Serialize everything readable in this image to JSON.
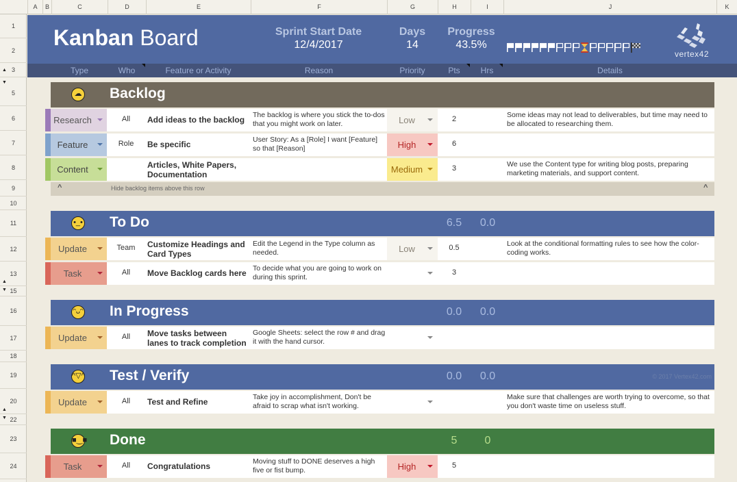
{
  "spreadsheet": {
    "columns": [
      "A",
      "B",
      "C",
      "D",
      "E",
      "F",
      "G",
      "H",
      "I",
      "J",
      "K"
    ],
    "rows": [
      "1",
      "2",
      "3",
      "5",
      "6",
      "7",
      "8",
      "9",
      "10",
      "11",
      "12",
      "13",
      "15",
      "16",
      "17",
      "18",
      "19",
      "20",
      "22",
      "23",
      "24"
    ]
  },
  "header": {
    "title_bold": "Kanban",
    "title_rest": " Board",
    "sprint_label": "Sprint Start Date",
    "sprint_value": "12/4/2017",
    "days_label": "Days",
    "days_value": "14",
    "progress_label": "Progress",
    "progress_value": "43.5%",
    "progress_fraction": 0.435,
    "flag_track": "▀▀▀▀▀▀ppp⌛ppppp🏁",
    "logo_text": "vertex42"
  },
  "table_header": {
    "type": "Type",
    "who": "Who",
    "feature": "Feature or Activity",
    "reason": "Reason",
    "priority": "Priority",
    "pts": "Pts",
    "hrs": "Hrs",
    "details": "Details"
  },
  "lanes": [
    {
      "name": "Backlog",
      "emoji": "sleeping-face",
      "emoji_glyph": "z",
      "pts": "",
      "hrs": "",
      "color": "#726a5c"
    },
    {
      "name": "To Do",
      "emoji": "neutral-face",
      "emoji_glyph": "•‿•",
      "pts": "6.5",
      "hrs": "0.0",
      "color": "#5069a1"
    },
    {
      "name": "In Progress",
      "emoji": "smiling-face",
      "emoji_glyph": "ᵔᴗᵔ",
      "pts": "0.0",
      "hrs": "0.0",
      "color": "#5069a1"
    },
    {
      "name": "Test / Verify",
      "emoji": "sweat-smile-face",
      "emoji_glyph": "^▽^",
      "pts": "0.0",
      "hrs": "0.0",
      "color": "#5069a1",
      "copyright": "© 2017 Vertex42.com"
    },
    {
      "name": "Done",
      "emoji": "sunglasses-face",
      "emoji_glyph": "■‿■",
      "pts": "5",
      "hrs": "0",
      "color": "#417d42"
    }
  ],
  "cards": [
    {
      "lane": 0,
      "type": "Research",
      "who": "All",
      "feature": "Add ideas to the backlog",
      "reason": "The backlog is where you stick the to-dos that you might work on later.",
      "priority": "Low",
      "pts": "2",
      "details": "Some ideas may not lead to deliverables, but time may need to be allocated to researching them."
    },
    {
      "lane": 0,
      "type": "Feature",
      "who": "Role",
      "feature": "Be specific",
      "reason": "User Story: As a [Role] I want [Feature] so that [Reason]",
      "priority": "High",
      "pts": "6",
      "details": ""
    },
    {
      "lane": 0,
      "type": "Content",
      "who": "",
      "feature": "Articles, White Papers, Documentation",
      "reason": "",
      "priority": "Medium",
      "pts": "3",
      "details": "We use the Content type for writing blog posts, preparing marketing materials, and support content."
    },
    {
      "lane": 1,
      "type": "Update",
      "who": "Team",
      "feature": "Customize Headings and Card Types",
      "reason": "Edit the Legend in the Type column as needed.",
      "priority": "Low",
      "pts": "0.5",
      "details": "Look at the conditional formatting rules to see how the color-coding works."
    },
    {
      "lane": 1,
      "type": "Task",
      "who": "All",
      "feature": "Move Backlog cards here",
      "reason": "To decide what you are going to work on during this sprint.",
      "priority": "",
      "pts": "3",
      "details": ""
    },
    {
      "lane": 2,
      "type": "Update",
      "who": "All",
      "feature": "Move tasks between lanes to track completion",
      "reason": "Google Sheets: select the row # and drag it with the hand cursor.",
      "priority": "",
      "pts": "",
      "details": ""
    },
    {
      "lane": 3,
      "type": "Update",
      "who": "All",
      "feature": "Test and Refine",
      "reason": "Take joy in accomplishment, Don't be afraid to scrap what isn't working.",
      "priority": "",
      "pts": "",
      "details": "Make sure that challenges are worth trying to overcome, so that you don't waste time on useless stuff."
    },
    {
      "lane": 4,
      "type": "Task",
      "who": "All",
      "feature": "Congratulations",
      "reason": "Moving stuff to DONE deserves a high five or fist bump.",
      "priority": "High",
      "pts": "5",
      "details": ""
    }
  ],
  "backlog_divider": {
    "caret": "^",
    "text": "Hide backlog items above this row"
  },
  "type_colors": {
    "Research": {
      "bg": "#e0d3e1",
      "stripe": "#9b7bb8",
      "arrow": "#9b7bb8",
      "text": "#555"
    },
    "Feature": {
      "bg": "#b6c9e0",
      "stripe": "#7fa2cc",
      "arrow": "#4e74a8",
      "text": "#444"
    },
    "Content": {
      "bg": "#c7de98",
      "stripe": "#a1c764",
      "arrow": "#6b9a33",
      "text": "#444"
    },
    "Update": {
      "bg": "#f3d28f",
      "stripe": "#ecb656",
      "arrow": "#a0622a",
      "text": "#555"
    },
    "Task": {
      "bg": "#e79d8d",
      "stripe": "#d9665a",
      "arrow": "#b0273a",
      "text": "#555"
    }
  },
  "priority_colors": {
    "Low": {
      "bg": "#f6f4ee",
      "text": "#8a8478"
    },
    "High": {
      "bg": "#f7c8c2",
      "text": "#b42525"
    },
    "Medium": {
      "bg": "#faeb8e",
      "text": "#9a6a0a"
    },
    "": {
      "bg": "#ffffff",
      "text": "#333"
    }
  }
}
